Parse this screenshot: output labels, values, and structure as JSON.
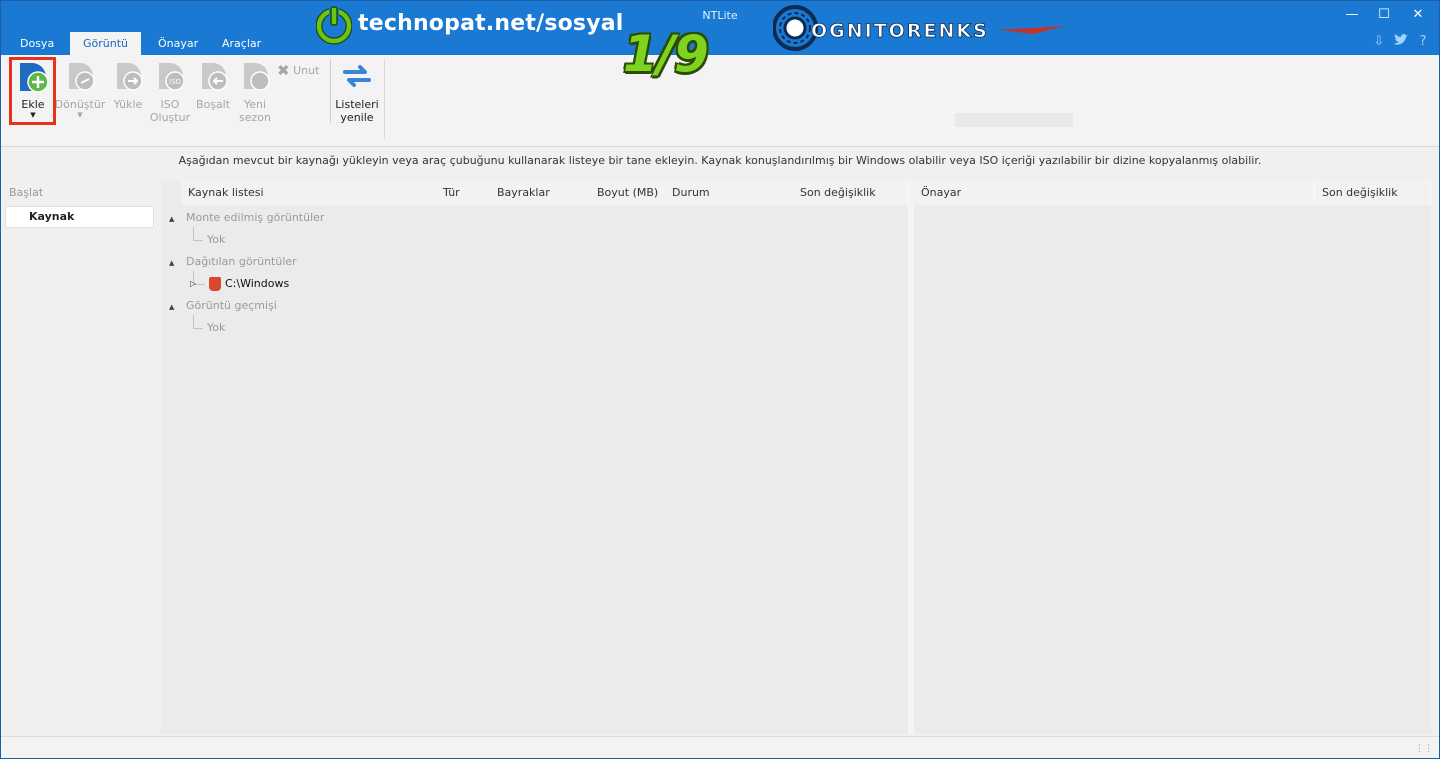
{
  "window": {
    "title": "NTLite"
  },
  "tabs": [
    {
      "label": "Dosya"
    },
    {
      "label": "Görüntü"
    },
    {
      "label": "Önayar"
    },
    {
      "label": "Araçlar"
    }
  ],
  "watermark": {
    "site": "technopat.net/sosyal",
    "step": "1/9",
    "brand": "OGNITORENKS"
  },
  "toolbar": {
    "add": "Ekle",
    "convert": "Dönüştür",
    "load": "Yükle",
    "iso_line1": "ISO",
    "iso_line2": "Oluştur",
    "unload": "Boşalt",
    "new_line1": "Yeni",
    "new_line2": "sezon",
    "forget": "Unut",
    "refresh_line1": "Listeleri",
    "refresh_line2": "yenile"
  },
  "info_text": "Aşağıdan mevcut bir kaynağı yükleyin veya araç çubuğunu kullanarak listeye bir tane ekleyin. Kaynak konuşlandırılmış bir Windows olabilir veya ISO içeriği yazılabilir bir dizine kopyalanmış olabilir.",
  "sidebar": {
    "section": "Başlat",
    "items": [
      {
        "label": "Kaynak"
      }
    ]
  },
  "source_list": {
    "columns": [
      "Kaynak listesi",
      "Tür",
      "Bayraklar",
      "Boyut (MB)",
      "Durum",
      "Son değişiklik"
    ],
    "groups": [
      {
        "label": "Monte edilmiş görüntüler",
        "child": "Yok"
      },
      {
        "label": "Dağıtılan görüntüler",
        "child": "C:\\Windows"
      },
      {
        "label": "Görüntü geçmişi",
        "child": "Yok"
      }
    ]
  },
  "preset_list": {
    "columns": [
      "Önayar",
      "Son değişiklik"
    ]
  }
}
